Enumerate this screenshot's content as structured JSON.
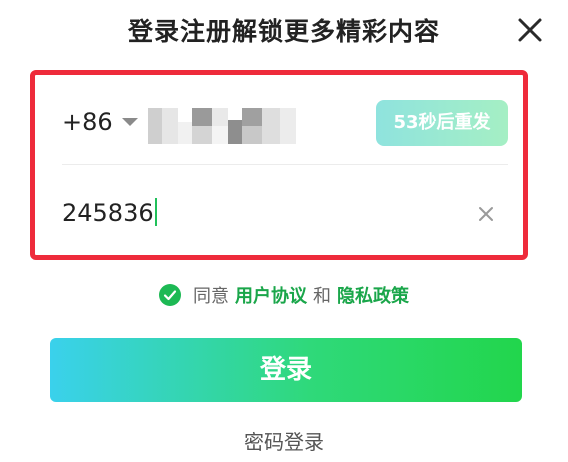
{
  "header": {
    "title": "登录注册解锁更多精彩内容",
    "close_icon": "close-icon"
  },
  "phone": {
    "country_code": "+86",
    "dropdown_icon": "chevron-down-icon",
    "masked": true,
    "resend_label": "53秒后重发",
    "resend_colors": [
      "#8fe3de",
      "#a5efc4"
    ]
  },
  "code": {
    "value": "245836",
    "clear_icon": "clear-icon"
  },
  "agreement": {
    "prefix": "同意",
    "user_agreement": "用户协议",
    "conjunction": "和",
    "privacy_policy": "隐私政策",
    "checked": true,
    "accent": "#1aa64a"
  },
  "actions": {
    "login_label": "登录",
    "password_login_label": "密码登录"
  },
  "highlight_color": "#ee2b3b"
}
